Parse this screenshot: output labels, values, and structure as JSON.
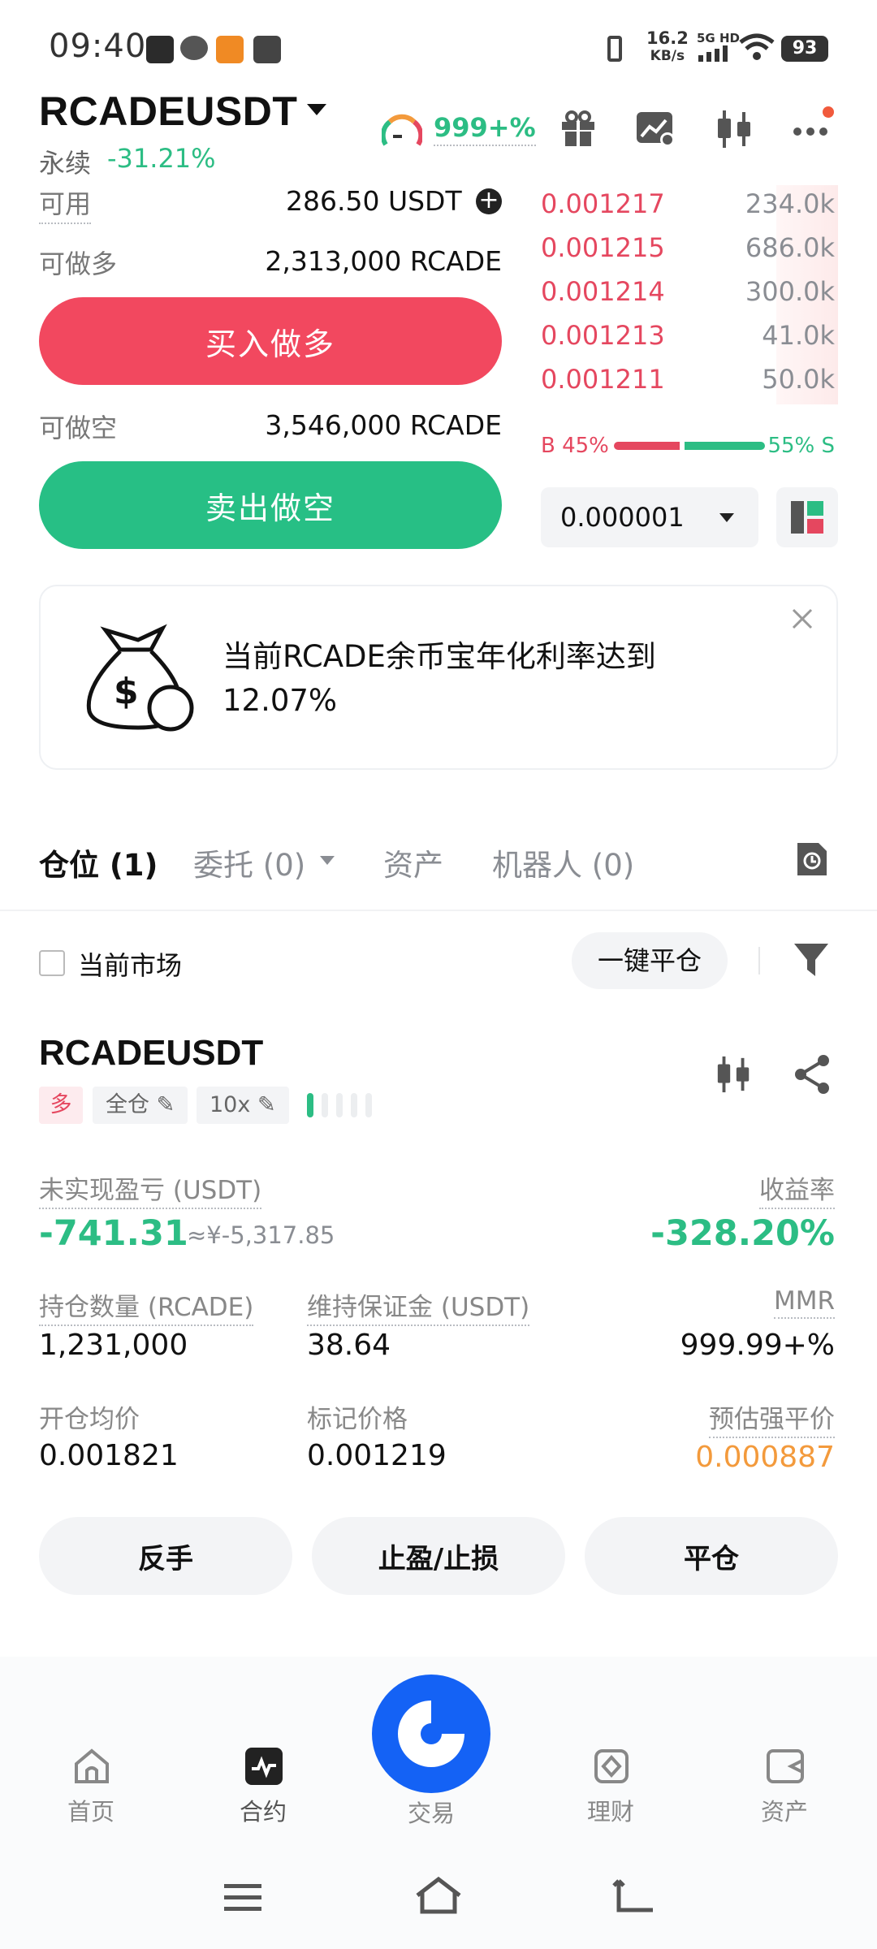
{
  "status_bar": {
    "time": "09:40",
    "net_speed": "16.2",
    "net_unit": "KB/s",
    "signal_label": "5G HD",
    "battery": "93"
  },
  "header": {
    "pair": "RCADEUSDT",
    "perpetual_label": "永续",
    "change": "-31.21%",
    "risk_value": "999+%"
  },
  "trade": {
    "available_label": "可用",
    "available_value": "286.50 USDT",
    "long_max_label": "可做多",
    "long_max_value": "2,313,000 RCADE",
    "buy_button": "买入做多",
    "short_max_label": "可做空",
    "short_max_value": "3,546,000 RCADE",
    "sell_button": "卖出做空"
  },
  "orderbook": {
    "asks": [
      {
        "price": "0.001217",
        "qty": "234.0k"
      },
      {
        "price": "0.001215",
        "qty": "686.0k"
      },
      {
        "price": "0.001214",
        "qty": "300.0k"
      },
      {
        "price": "0.001213",
        "qty": "41.0k"
      },
      {
        "price": "0.001211",
        "qty": "50.0k"
      }
    ],
    "buy_ratio_label": "B 45%",
    "sell_ratio_label": "55% S",
    "buy_ratio": 0.45,
    "precision": "0.000001"
  },
  "banner": {
    "text_line1": "当前RCADE余币宝年化利率达到",
    "text_line2": "12.07%"
  },
  "tabs": {
    "positions": "仓位 (1)",
    "orders": "委托 (0)",
    "assets": "资产",
    "bots": "机器人 (0)"
  },
  "filter": {
    "current_market": "当前市场",
    "close_all": "一键平仓"
  },
  "position": {
    "symbol": "RCADEUSDT",
    "side": "多",
    "margin_mode": "全仓",
    "leverage": "10x",
    "unrealized_label": "未实现盈亏 (USDT)",
    "unrealized_value": "-741.31",
    "unrealized_cny": "≈¥-5,317.85",
    "roe_label": "收益率",
    "roe_value": "-328.20%",
    "size_label": "持仓数量 (RCADE)",
    "size_value": "1,231,000",
    "maint_margin_label": "维持保证金 (USDT)",
    "maint_margin_value": "38.64",
    "mmr_label": "MMR",
    "mmr_value": "999.99+%",
    "entry_label": "开仓均价",
    "entry_value": "0.001821",
    "mark_label": "标记价格",
    "mark_value": "0.001219",
    "liq_label": "预估强平价",
    "liq_value": "0.000887"
  },
  "actions": {
    "reverse": "反手",
    "tp_sl": "止盈/止损",
    "close": "平仓"
  },
  "bottom_nav": {
    "home": "首页",
    "futures": "合约",
    "trade": "交易",
    "earn": "理财",
    "assets": "资产"
  },
  "colors": {
    "red": "#e5475f",
    "green": "#2cbd84",
    "orange": "#f39a3c",
    "brand_blue": "#1462f5"
  }
}
